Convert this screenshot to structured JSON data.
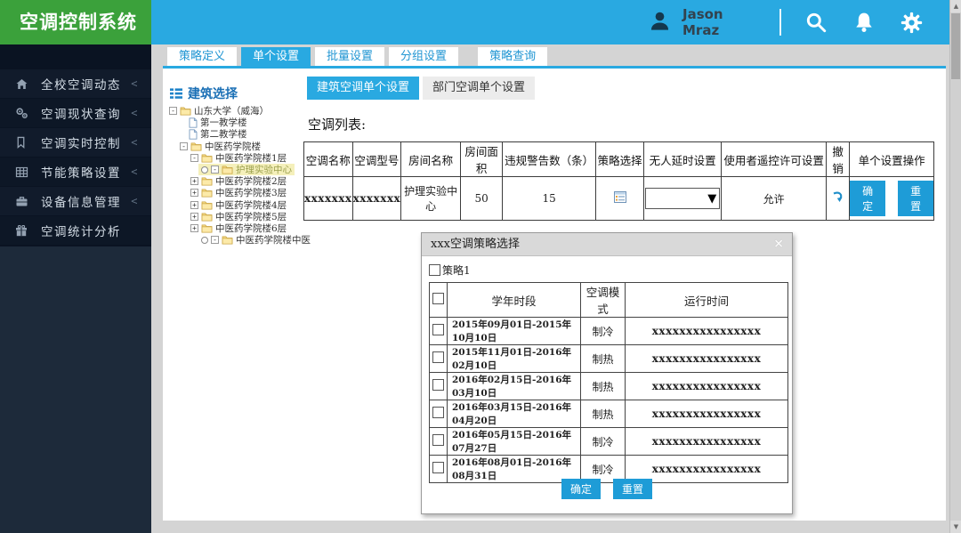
{
  "app": {
    "title": "空调控制系统"
  },
  "header": {
    "user_name": "Jason Mraz",
    "icons": [
      "user-avatar-icon",
      "search-icon",
      "bell-icon",
      "gear-icon"
    ]
  },
  "sidebar": {
    "items": [
      {
        "label": "全校空调动态",
        "icon": "home-icon",
        "has_chevron": true
      },
      {
        "label": "空调现状查询",
        "icon": "gears-icon",
        "has_chevron": true
      },
      {
        "label": "空调实时控制",
        "icon": "bookmark-icon",
        "has_chevron": true
      },
      {
        "label": "节能策略设置",
        "icon": "table-icon",
        "has_chevron": true
      },
      {
        "label": "设备信息管理",
        "icon": "briefcase-icon",
        "has_chevron": true
      },
      {
        "label": "空调统计分析",
        "icon": "gift-icon",
        "has_chevron": false
      }
    ]
  },
  "tabs": [
    {
      "label": "策略定义",
      "active": false
    },
    {
      "label": "单个设置",
      "active": true
    },
    {
      "label": "批量设置",
      "active": false
    },
    {
      "label": "分组设置",
      "active": false
    },
    {
      "label": "策略查询",
      "active": false
    }
  ],
  "tree": {
    "title": "建筑选择",
    "icon": "list-icon",
    "nodes": [
      {
        "label": "山东大学（威海）",
        "depth": 0,
        "icon": "folder-icon",
        "expander": "minus",
        "radio": false,
        "selected": false
      },
      {
        "label": "第一教学楼",
        "depth": 1,
        "icon": "file-icon",
        "expander": "",
        "radio": false,
        "selected": false
      },
      {
        "label": "第二教学楼",
        "depth": 1,
        "icon": "file-icon",
        "expander": "",
        "radio": false,
        "selected": false
      },
      {
        "label": "中医药学院楼",
        "depth": 1,
        "icon": "folder-icon",
        "expander": "minus",
        "radio": false,
        "selected": false
      },
      {
        "label": "中医药学院楼1层",
        "depth": 2,
        "icon": "folder-icon",
        "expander": "minus",
        "radio": false,
        "selected": false
      },
      {
        "label": "护理实验中心",
        "depth": 3,
        "icon": "folder-icon",
        "expander": "minus",
        "radio": true,
        "selected": true
      },
      {
        "label": "中医药学院楼2层",
        "depth": 2,
        "icon": "folder-icon",
        "expander": "plus",
        "radio": false,
        "selected": false
      },
      {
        "label": "中医药学院楼3层",
        "depth": 2,
        "icon": "folder-icon",
        "expander": "plus",
        "radio": false,
        "selected": false
      },
      {
        "label": "中医药学院楼4层",
        "depth": 2,
        "icon": "folder-icon",
        "expander": "plus",
        "radio": false,
        "selected": false
      },
      {
        "label": "中医药学院楼5层",
        "depth": 2,
        "icon": "folder-icon",
        "expander": "plus",
        "radio": false,
        "selected": false
      },
      {
        "label": "中医药学院楼6层",
        "depth": 2,
        "icon": "folder-icon",
        "expander": "plus",
        "radio": false,
        "selected": false
      },
      {
        "label": "中医药学院楼中医",
        "depth": 3,
        "icon": "folder-icon",
        "expander": "minus",
        "radio": true,
        "selected": false
      }
    ]
  },
  "subtabs": [
    {
      "label": "建筑空调单个设置",
      "active": true
    },
    {
      "label": "部门空调单个设置",
      "active": false
    }
  ],
  "ac_list": {
    "label": "空调列表:",
    "headers": [
      "空调名称",
      "空调型号",
      "房间名称",
      "房间面积",
      "违规警告数（条）",
      "策略选择",
      "无人延时设置",
      "使用者遥控许可设置",
      "撤销",
      "单个设置操作"
    ],
    "row": {
      "name": "xxxxxxx",
      "model": "xxxxxxx",
      "room": "护理实验中心",
      "area": "50",
      "warnings": "15",
      "policy_icon": "policy-grid-icon",
      "delay_value": "",
      "remote_permission": "允许",
      "undo_icon": "undo-arrow-icon",
      "confirm_label": "确定",
      "reset_label": "重置"
    }
  },
  "modal": {
    "title": "xxx空调策略选择",
    "close_icon": "close-icon",
    "close_glyph": "×",
    "policy_checkbox_label": "策略1",
    "table": {
      "headers": [
        "学年时段",
        "空调模式",
        "运行时间"
      ],
      "rows": [
        {
          "period": "2015年09月01日-2015年10月10日",
          "mode": "制冷",
          "runtime": "xxxxxxxxxxxxxxxx"
        },
        {
          "period": "2015年11月01日-2016年02月10日",
          "mode": "制热",
          "runtime": "xxxxxxxxxxxxxxxx"
        },
        {
          "period": "2016年02月15日-2016年03月10日",
          "mode": "制热",
          "runtime": "xxxxxxxxxxxxxxxx"
        },
        {
          "period": "2016年03月15日-2016年04月20日",
          "mode": "制热",
          "runtime": "xxxxxxxxxxxxxxxx"
        },
        {
          "period": "2016年05月15日-2016年07月27日",
          "mode": "制冷",
          "runtime": "xxxxxxxxxxxxxxxx"
        },
        {
          "period": "2016年08月01日-2016年08月31日",
          "mode": "制冷",
          "runtime": "xxxxxxxxxxxxxxxx"
        }
      ]
    },
    "confirm_label": "确定",
    "reset_label": "重置"
  },
  "colors": {
    "header_blue": "#29a9e1",
    "logo_green": "#3ba13b",
    "sidebar_dark": "#0a1322",
    "accent_blue": "#2196d3",
    "button_blue": "#1e9cd7",
    "tree_selected_bg": "#f5f0bb"
  }
}
